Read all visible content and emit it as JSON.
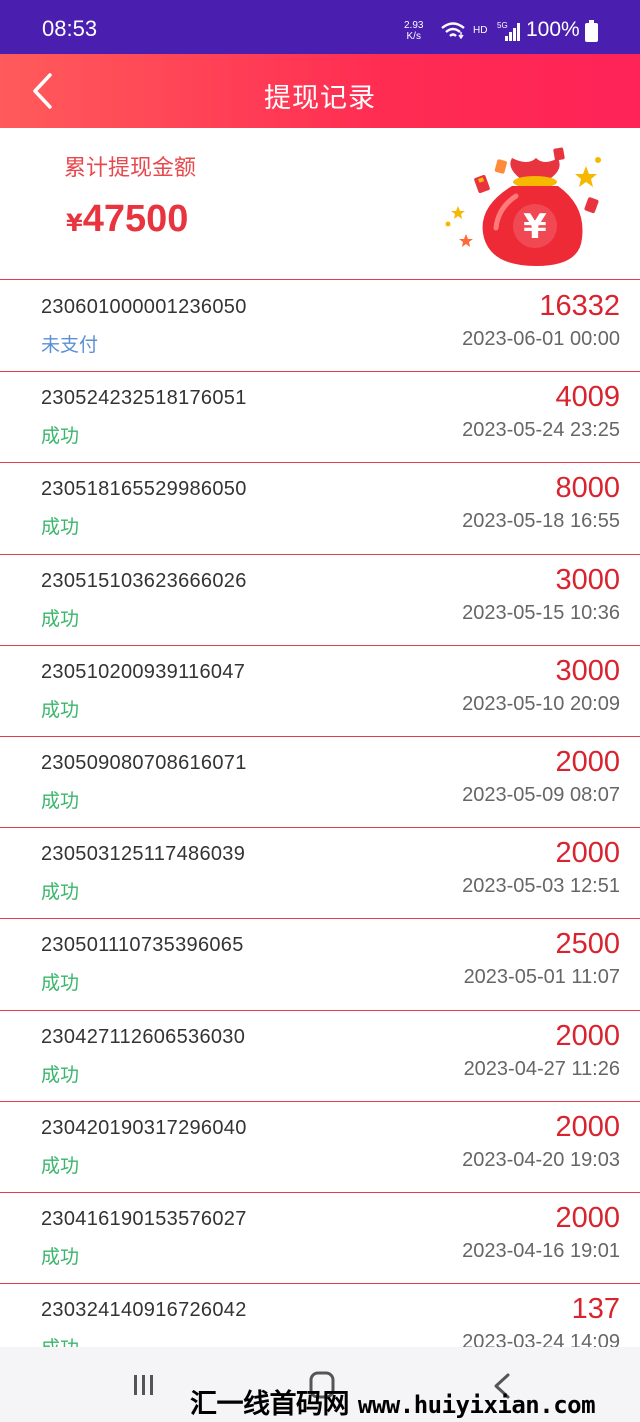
{
  "status_bar": {
    "time": "08:53",
    "net_speed_value": "2.93",
    "net_speed_unit": "K/s",
    "hd_label": "HD",
    "network_label": "5G",
    "battery": "100%"
  },
  "header": {
    "title": "提现记录"
  },
  "summary": {
    "label": "累计提现金额",
    "currency": "¥",
    "total": "47500"
  },
  "records": [
    {
      "order": "230601000001236050",
      "status": "未支付",
      "amount": "16332",
      "date": "2023-06-01 00:00"
    },
    {
      "order": "230524232518176051",
      "status": "成功",
      "amount": "4009",
      "date": "2023-05-24 23:25"
    },
    {
      "order": "230518165529986050",
      "status": "成功",
      "amount": "8000",
      "date": "2023-05-18 16:55"
    },
    {
      "order": "230515103623666026",
      "status": "成功",
      "amount": "3000",
      "date": "2023-05-15 10:36"
    },
    {
      "order": "230510200939116047",
      "status": "成功",
      "amount": "3000",
      "date": "2023-05-10 20:09"
    },
    {
      "order": "230509080708616071",
      "status": "成功",
      "amount": "2000",
      "date": "2023-05-09 08:07"
    },
    {
      "order": "230503125117486039",
      "status": "成功",
      "amount": "2000",
      "date": "2023-05-03 12:51"
    },
    {
      "order": "230501110735396065",
      "status": "成功",
      "amount": "2500",
      "date": "2023-05-01 11:07"
    },
    {
      "order": "230427112606536030",
      "status": "成功",
      "amount": "2000",
      "date": "2023-04-27 11:26"
    },
    {
      "order": "230420190317296040",
      "status": "成功",
      "amount": "2000",
      "date": "2023-04-20 19:03"
    },
    {
      "order": "230416190153576027",
      "status": "成功",
      "amount": "2000",
      "date": "2023-04-16 19:01"
    },
    {
      "order": "230324140916726042",
      "status": "成功",
      "amount": "137",
      "date": "2023-03-24 14:09"
    }
  ],
  "watermark": {
    "cn": "汇一线首码网",
    "url": "www.huiyixian.com"
  },
  "colors": {
    "status_bar": "#4a1fb0",
    "header_start": "#ff5b5b",
    "header_end": "#ff2358",
    "amount": "#d9232e",
    "success": "#3ab66b",
    "unpaid": "#5b8fd6"
  }
}
